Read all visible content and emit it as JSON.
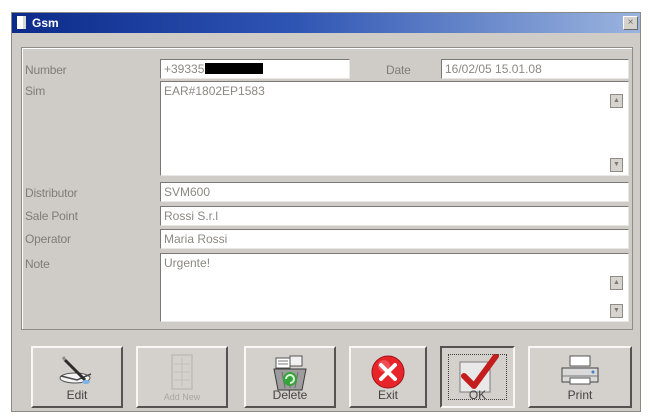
{
  "window": {
    "title": "Gsm",
    "close_glyph": "×"
  },
  "form": {
    "number_label": "Number",
    "number_value": "+39335",
    "date_label": "Date",
    "date_value": "16/02/05 15.01.08",
    "sim_label": "Sim",
    "sim_value": "EAR#1802EP1583",
    "distributor_label": "Distributor",
    "distributor_value": "SVM600",
    "sale_point_label": "Sale Point",
    "sale_point_value": "Rossi S.r.l",
    "operator_label": "Operator",
    "operator_value": "Maria Rossi",
    "note_label": "Note",
    "note_value": "Urgente!"
  },
  "scroll": {
    "up": "▲",
    "down": "▼"
  },
  "toolbar": {
    "edit_label": "Edit",
    "add_label": "Add New",
    "delete_label": "Delete",
    "exit_label": "Exit",
    "ok_label": "OK",
    "print_label": "Print"
  }
}
